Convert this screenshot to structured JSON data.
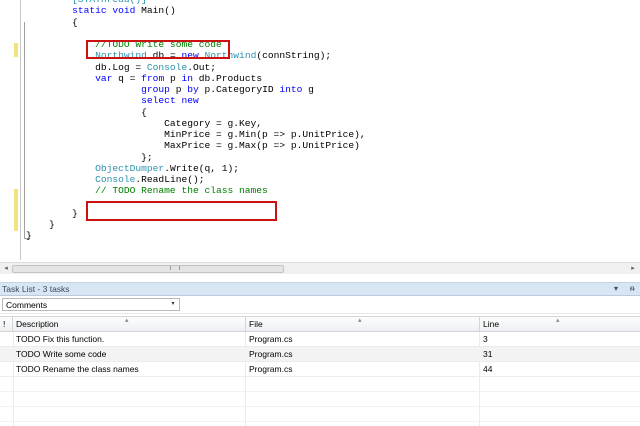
{
  "editor": {
    "lines": [
      [
        {
          "t": "        "
        },
        {
          "t": "[STAThread()]",
          "c": "ty"
        }
      ],
      [
        {
          "t": "        "
        },
        {
          "t": "static",
          "c": "kw"
        },
        {
          "t": " "
        },
        {
          "t": "void",
          "c": "kw"
        },
        {
          "t": " Main()"
        }
      ],
      [
        {
          "t": "        {"
        }
      ],
      [
        {
          "t": ""
        }
      ],
      [
        {
          "t": "            "
        },
        {
          "t": "//TODO Write some code",
          "c": "cm"
        }
      ],
      [
        {
          "t": "            "
        },
        {
          "t": "Northwind",
          "c": "ty"
        },
        {
          "t": " db = "
        },
        {
          "t": "new",
          "c": "kw"
        },
        {
          "t": " "
        },
        {
          "t": "Northwind",
          "c": "ty"
        },
        {
          "t": "(connString);"
        }
      ],
      [
        {
          "t": "            db.Log = "
        },
        {
          "t": "Console",
          "c": "ty"
        },
        {
          "t": ".Out;"
        }
      ],
      [
        {
          "t": "            "
        },
        {
          "t": "var",
          "c": "kw"
        },
        {
          "t": " q = "
        },
        {
          "t": "from",
          "c": "kw"
        },
        {
          "t": " p "
        },
        {
          "t": "in",
          "c": "kw"
        },
        {
          "t": " db.Products"
        }
      ],
      [
        {
          "t": "                    "
        },
        {
          "t": "group",
          "c": "kw"
        },
        {
          "t": " p "
        },
        {
          "t": "by",
          "c": "kw"
        },
        {
          "t": " p.CategoryID "
        },
        {
          "t": "into",
          "c": "kw"
        },
        {
          "t": " g"
        }
      ],
      [
        {
          "t": "                    "
        },
        {
          "t": "select",
          "c": "kw"
        },
        {
          "t": " "
        },
        {
          "t": "new",
          "c": "kw"
        }
      ],
      [
        {
          "t": "                    {"
        }
      ],
      [
        {
          "t": "                        Category = g.Key,"
        }
      ],
      [
        {
          "t": "                        MinPrice = g.Min(p => p.UnitPrice),"
        }
      ],
      [
        {
          "t": "                        MaxPrice = g.Max(p => p.UnitPrice)"
        }
      ],
      [
        {
          "t": "                    };"
        }
      ],
      [
        {
          "t": "            "
        },
        {
          "t": "ObjectDumper",
          "c": "ty"
        },
        {
          "t": ".Write(q, 1);"
        }
      ],
      [
        {
          "t": "            "
        },
        {
          "t": "Console",
          "c": "ty"
        },
        {
          "t": ".ReadLine();"
        }
      ],
      [
        {
          "t": "            "
        },
        {
          "t": "// TODO Rename the class names",
          "c": "cm"
        }
      ],
      [
        {
          "t": ""
        }
      ],
      [
        {
          "t": "        }"
        }
      ],
      [
        {
          "t": "    }"
        }
      ],
      [
        {
          "t": "}"
        }
      ]
    ]
  },
  "scrollbar": {
    "left_icon": "triangle-left-icon",
    "right_icon": "triangle-right-icon",
    "left_arrow": "◂",
    "right_arrow": "▸"
  },
  "tasklist": {
    "title": "Task List - 3 tasks",
    "pin_glyph": "▾",
    "close_glyph": "ᵰ",
    "category": {
      "selected": "Comments",
      "dropdown_glyph": "▾"
    },
    "columns": [
      {
        "label": "!"
      },
      {
        "label": "Description",
        "sorted": true
      },
      {
        "label": "File",
        "sorted": true
      },
      {
        "label": "Line",
        "sorted": true
      }
    ],
    "sort_glyph": "▴",
    "rows": [
      {
        "description": "TODO Fix this function.",
        "file": "Program.cs",
        "line": "3"
      },
      {
        "description": "TODO Write some code",
        "file": "Program.cs",
        "line": "31"
      },
      {
        "description": "TODO Rename the class names",
        "file": "Program.cs",
        "line": "44"
      }
    ]
  },
  "colors": {
    "keyword": "#0000ff",
    "type": "#2b91af",
    "comment": "#008000",
    "highlight_box": "#cc1111",
    "change_bar": "#f1e283",
    "title_bar": "#d8e6f4"
  }
}
